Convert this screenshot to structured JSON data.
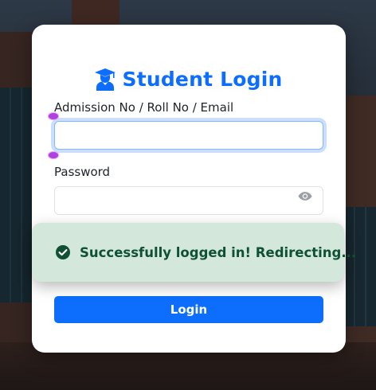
{
  "background": {
    "description_icon": "campus-building-photo"
  },
  "login_card": {
    "title": "Student Login",
    "title_icon": "user-graduate-icon",
    "accent_color": "#0d6efd",
    "username": {
      "label": "Admission No / Roll No / Email",
      "value": "",
      "placeholder": ""
    },
    "password": {
      "label": "Password",
      "value": "",
      "placeholder": "",
      "toggle_icon": "eye-icon"
    },
    "login_button_label": "Login"
  },
  "toast": {
    "message": "Successfully logged in! Redirecting...",
    "icon": "check-circle-icon",
    "background_color": "#d3e8db",
    "text_color": "#0f5132"
  }
}
